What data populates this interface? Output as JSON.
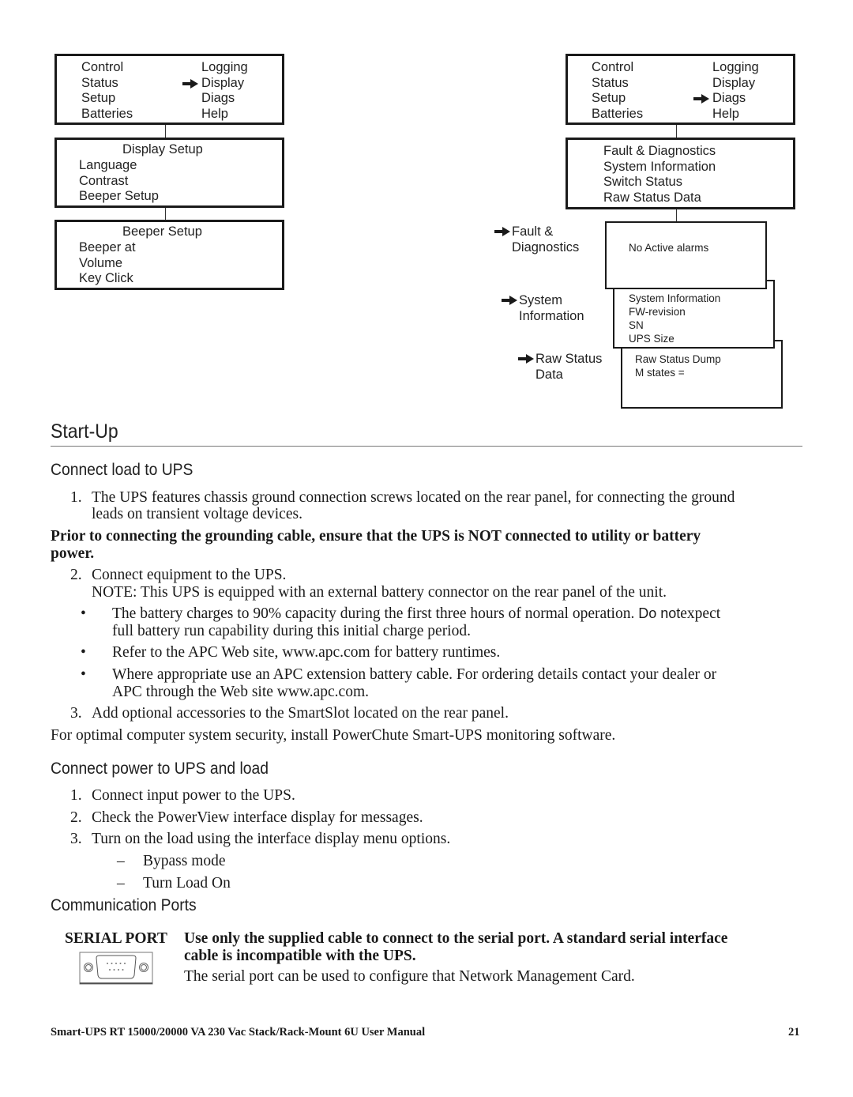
{
  "diagram_left": {
    "main_menu": {
      "col1": [
        "Control",
        "Status",
        "Setup",
        "Batteries"
      ],
      "col2": [
        "Logging",
        "Display",
        "Diags",
        "Help"
      ],
      "selected": "Display"
    },
    "display_setup": {
      "title": "Display Setup",
      "items": [
        "Language",
        "Contrast",
        "Beeper Setup"
      ]
    },
    "beeper_setup": {
      "title": "Beeper Setup",
      "items": [
        "Beeper at",
        "Volume",
        "Key Click"
      ]
    }
  },
  "diagram_right": {
    "main_menu": {
      "col1": [
        "Control",
        "Status",
        "Setup",
        "Batteries"
      ],
      "col2": [
        "Logging",
        "Display",
        "Diags",
        "Help"
      ],
      "selected": "Diags"
    },
    "diags_menu": {
      "items": [
        "Fault & Diagnostics",
        "System Information",
        "Switch Status",
        "Raw Status Data"
      ]
    },
    "fault_label": [
      "Fault &",
      "Diagnostics"
    ],
    "fault_screen": {
      "lines": [
        "No Active alarms"
      ]
    },
    "sysinfo_label": [
      "System",
      "Information"
    ],
    "sysinfo_screen": {
      "lines": [
        "System Information",
        "FW-revision",
        "SN",
        "UPS Size"
      ]
    },
    "raw_label": [
      "Raw Status",
      "Data"
    ],
    "raw_screen": {
      "lines": [
        "Raw Status Dump",
        "M states ="
      ]
    }
  },
  "startup": {
    "title": "Start-Up",
    "connect_load": {
      "heading": "Connect load to UPS",
      "step1_num": "1.",
      "step1_line1": "The UPS features chassis ground connection screws located on the rear panel, for connecting the ground",
      "step1_line2": "leads on transient voltage devices.",
      "warning_line1": "Prior to connecting the grounding cable, ensure that the UPS is NOT connected to utility or battery",
      "warning_line2": "power.",
      "step2_num": "2.",
      "step2_text": "Connect equipment to the UPS.",
      "note": "NOTE: This UPS is equipped with an external battery connector on the rear panel of the unit.",
      "bullets": [
        {
          "line1_a": "The battery charges to 90% capacity during the first three hours of normal operation. ",
          "line1_b": "Do not",
          "line1_c": "expect",
          "line2": "full battery run capability during this initial charge period."
        },
        {
          "line1": "Refer to the APC Web site, www.apc.com for battery runtimes."
        },
        {
          "line1": "Where appropriate use an APC extension battery cable. For ordering details contact your dealer or",
          "line2": "APC through the Web site www.apc.com."
        }
      ],
      "bullet_char": "•",
      "step3_num": "3.",
      "step3_text": "Add optional accessories to the SmartSlot located on the rear panel.",
      "closing": "For optimal computer system security, install PowerChute Smart-UPS monitoring software."
    },
    "connect_power": {
      "heading": "Connect power to UPS and load",
      "steps": [
        {
          "num": "1.",
          "text": "Connect input power to the UPS."
        },
        {
          "num": "2.",
          "text": "Check the PowerView interface display for messages."
        },
        {
          "num": "3.",
          "text": "Turn on the load using the interface display menu options."
        }
      ],
      "dash": "–",
      "substeps": [
        "Bypass mode",
        "Turn Load On"
      ]
    },
    "comm_ports": {
      "heading": "Communication Ports",
      "serial_label": "SERIAL PORT",
      "serial_icon": "db9-serial-port-icon",
      "warning_line1": "Use only the supplied cable to connect to the serial port. A standard serial interface",
      "warning_line2": "cable is incompatible with the UPS.",
      "info": "The serial port can be used to configure that Network Management Card."
    }
  },
  "footer": {
    "title": "Smart-UPS RT 15000/20000 VA  230 Vac  Stack/Rack-Mount 6U  User Manual",
    "page_number": "21"
  }
}
